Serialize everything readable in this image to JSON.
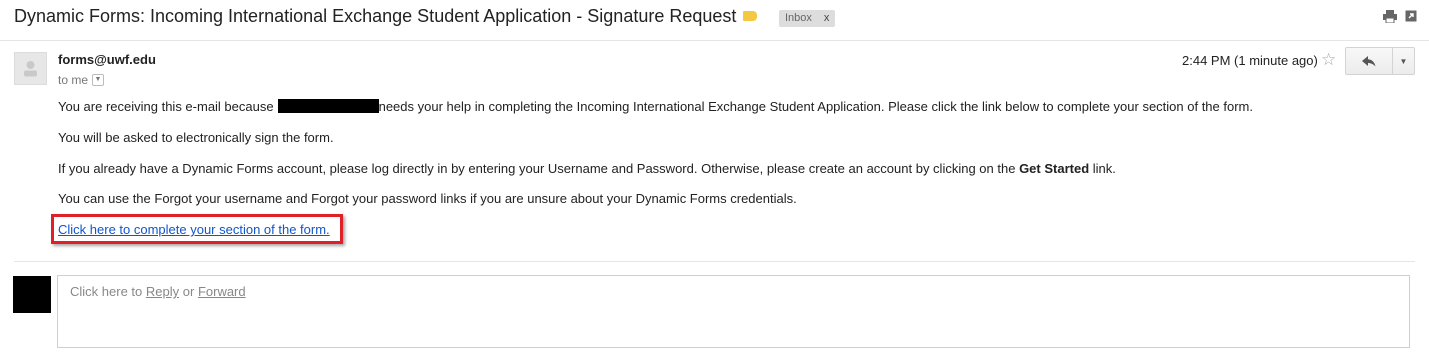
{
  "subject": "Dynamic Forms: Incoming International Exchange Student Application - Signature Request",
  "label_chip": {
    "text": "Inbox",
    "close": "x"
  },
  "label_color": "#f5c844",
  "icons": {
    "print": "print-icon",
    "popout": "popout-icon",
    "star": "star-icon",
    "reply": "reply-icon",
    "more": "chevron-down-icon"
  },
  "message": {
    "sender": "forms@uwf.edu",
    "to": "to me",
    "timestamp": "2:44 PM (1 minute ago)",
    "body": {
      "p1_before": "You are receiving this e-mail because",
      "p1_after": "needs your help in completing the Incoming International Exchange Student Application. Please click the link below to complete your section of the form.",
      "p2": "You will be asked to electronically sign the form.",
      "p3_before": "If you already have a Dynamic Forms account, please log directly in by entering your Username and Password. Otherwise, please create an account by clicking on the",
      "p3_bold": "Get Started",
      "p3_after": "link.",
      "p4": "You can use the Forgot your username and Forgot your password links if you are unsure about your Dynamic Forms credentials.",
      "link": "Click here to complete your section of the form."
    }
  },
  "reply_area": {
    "prefix": "Click here to",
    "reply": "Reply",
    "or": "or",
    "forward": "Forward"
  },
  "highlight_color": "#e11f26",
  "link_color": "#1155cc"
}
